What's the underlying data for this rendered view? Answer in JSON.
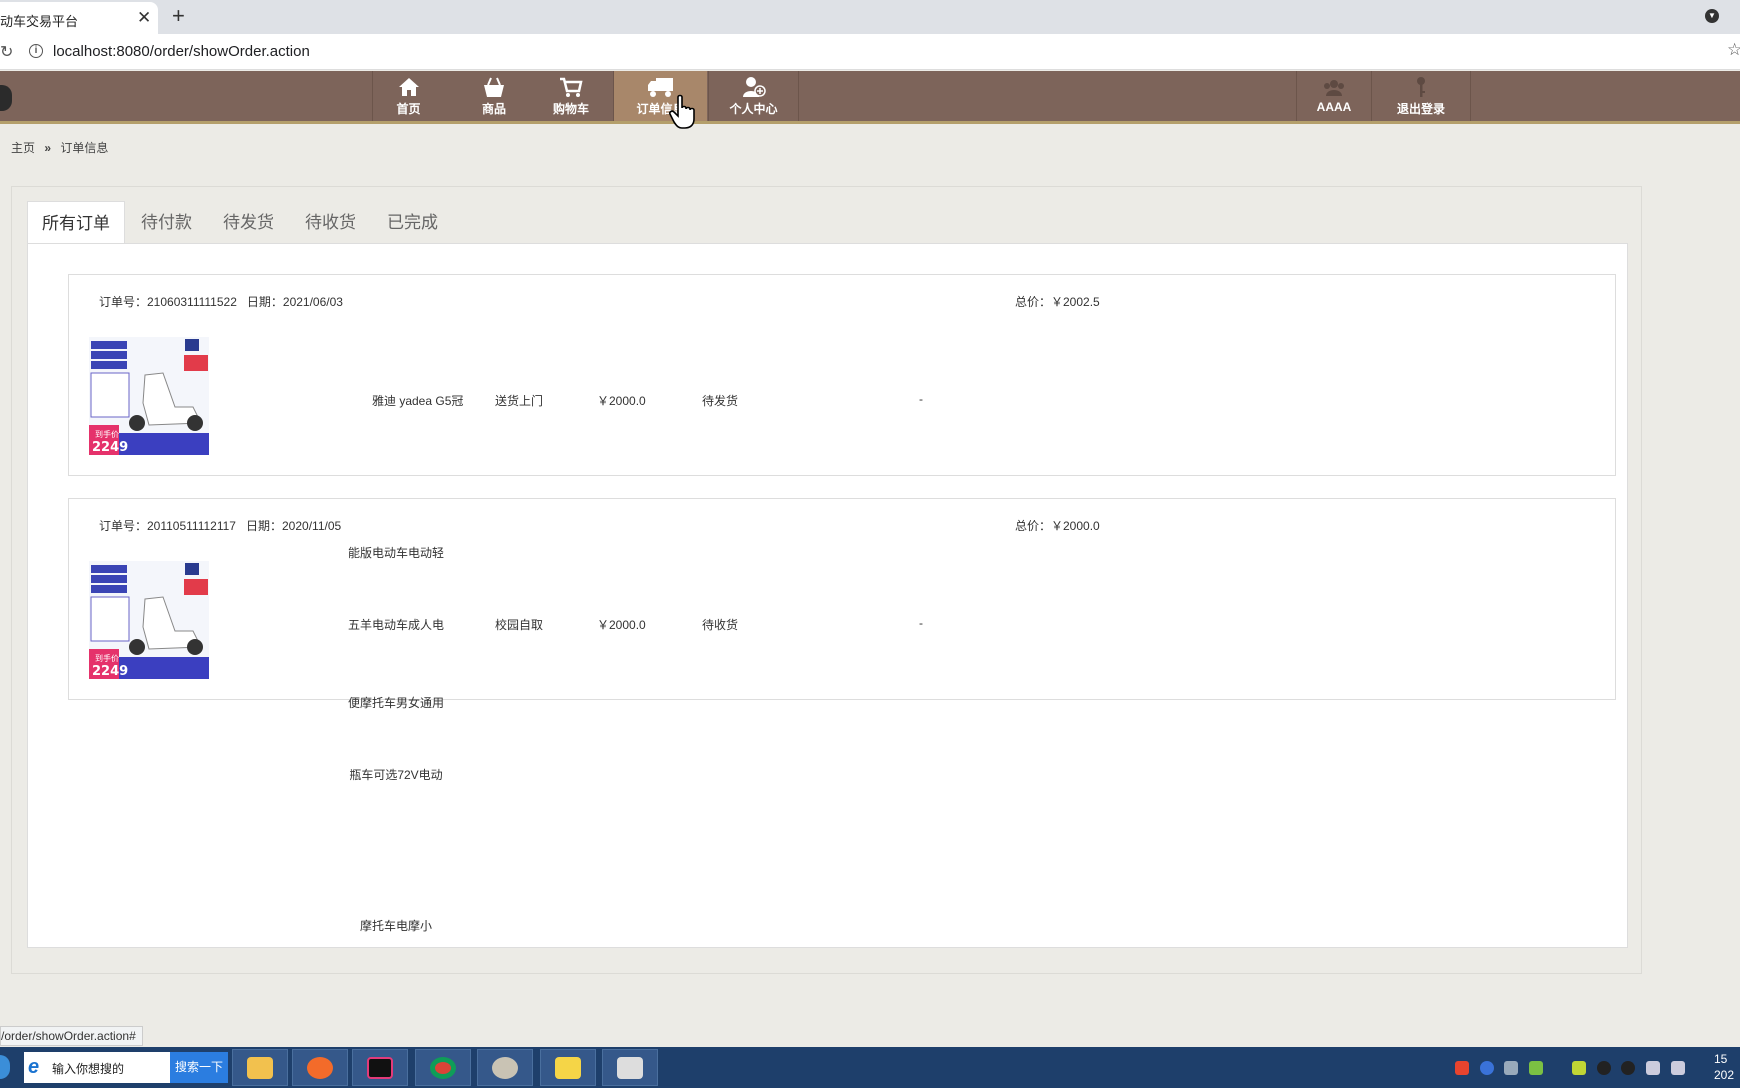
{
  "browser": {
    "tab_title": "动车交易平台",
    "tab_close": "✕",
    "new_tab": "+",
    "url": "localhost:8080/order/showOrder.action",
    "status_url": "/order/showOrder.action#"
  },
  "nav": {
    "items": [
      {
        "label": "首页",
        "icon": "home-icon"
      },
      {
        "label": "商品",
        "icon": "basket-icon"
      },
      {
        "label": "购物车",
        "icon": "cart-icon"
      },
      {
        "label": "订单信息",
        "icon": "truck-icon"
      },
      {
        "label": "个人中心",
        "icon": "user-add-icon"
      }
    ],
    "user": {
      "label": "AAAA",
      "icon": "users-icon"
    },
    "logout": {
      "label": "退出登录",
      "icon": "key-icon"
    }
  },
  "breadcrumb": {
    "home": "主页",
    "sep": "»",
    "current": "订单信息"
  },
  "order_tabs": [
    "所有订单",
    "待付款",
    "待发货",
    "待收货",
    "已完成"
  ],
  "orders": [
    {
      "number_label": "订单号：21060311111522",
      "date_label": "日期：2021/06/03",
      "total_label": "总价：￥2002.5",
      "product_name": "雅迪 yadea G5冠",
      "delivery": "送货上门",
      "price": "￥2000.0",
      "status": "待发货",
      "extra": "-",
      "thumb": {
        "badge": "到手价",
        "price": "2249"
      }
    },
    {
      "number_label": "订单号：20110511112117",
      "date_label": "日期：2020/11/05",
      "total_label": "总价：￥2000.0",
      "product_lines": [
        "能版电动车电动轻",
        "五羊电动车成人电",
        "便摩托车男女通用",
        "瓶车可选72V电动",
        "摩托车电摩小"
      ],
      "delivery": "校园自取",
      "price": "￥2000.0",
      "status": "待收货",
      "extra": "-",
      "thumb": {
        "badge": "到手价",
        "price": "2249"
      }
    }
  ],
  "taskbar": {
    "search_placeholder": "输入你想搜的",
    "search_button": "搜索一下",
    "clock_line1": "15",
    "clock_line2": "202"
  },
  "colors": {
    "nav_bg": "#7d645a",
    "nav_active": "#a8876a",
    "nav_border": "#b49f6b",
    "page_bg": "#ecebe6"
  }
}
